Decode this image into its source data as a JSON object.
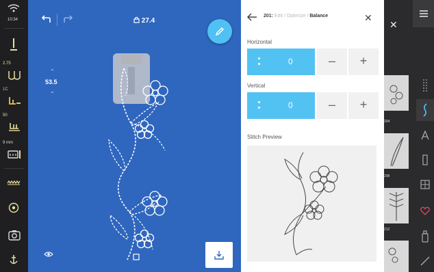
{
  "status": {
    "time": "10:34"
  },
  "left_sidebar": {
    "stitch_length": "2.75",
    "tension": "1C",
    "speed": "50",
    "presser_height": "9 mm"
  },
  "canvas": {
    "stitch_count": "27.4",
    "zoom": "53.5"
  },
  "balance_panel": {
    "stitch_number": "201:",
    "crumb_edit": "Edit",
    "crumb_optimize": "Optimize",
    "crumb_current": "Balance",
    "horizontal_label": "Horizontal",
    "horizontal_value": "0",
    "vertical_label": "Vertical",
    "vertical_value": "0",
    "minus_label": "–",
    "plus_label": "+",
    "preview_label": "Stitch Preview"
  },
  "library": {
    "thumb_numbers": [
      "204",
      "208",
      "212"
    ],
    "colors": {
      "accent": "#52c2f2",
      "canvas": "#2f66be",
      "sidebar": "#1f1f22",
      "heart": "#e5485a",
      "active_tab": "#4fc3f7"
    }
  }
}
